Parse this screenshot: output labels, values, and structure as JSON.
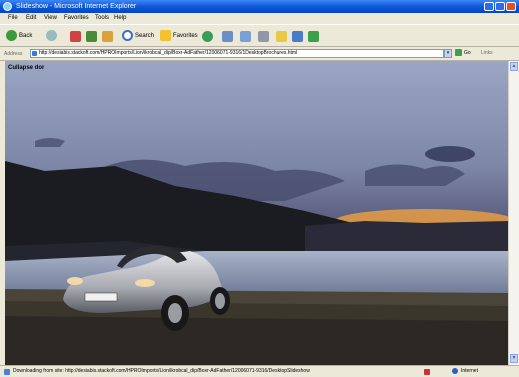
{
  "window": {
    "title": "Slideshow - Microsoft Internet Explorer"
  },
  "menu": [
    "File",
    "Edit",
    "View",
    "Favorites",
    "Tools",
    "Help"
  ],
  "toolbar": {
    "back_label": "Back",
    "search_label": "Search",
    "favorites_label": "Favorites"
  },
  "address": {
    "label": "Address",
    "url": "http://desiabis.stackoft.com/HPROImports/Lion/ikrobcal_dip/Boxr-AdFather/12006071-9316/1DesktopBrochures.html",
    "go_label": "Go",
    "links_label": "Links"
  },
  "page": {
    "caption": "Cullapse dor"
  },
  "status": {
    "text": "Downloading from site: http://desiabis.stackoft.com/HPROImports/Lion/ikrobcal_dip/Boxr-AdFather/12006071-9316/DesktopSlideshow",
    "zone": "Internet"
  },
  "colors": {
    "titlebar": "#0a55d6",
    "chrome": "#ece9d8",
    "content_bg": "#6f7896"
  },
  "icons": [
    "ie-icon",
    "back-arrow-icon",
    "forward-arrow-icon",
    "stop-icon",
    "refresh-icon",
    "home-icon",
    "search-icon",
    "favorites-star-icon",
    "media-icon",
    "history-icon",
    "mail-icon",
    "print-icon",
    "edit-icon",
    "discuss-icon",
    "messenger-icon",
    "go-arrow-icon",
    "page-icon",
    "internet-zone-icon"
  ]
}
